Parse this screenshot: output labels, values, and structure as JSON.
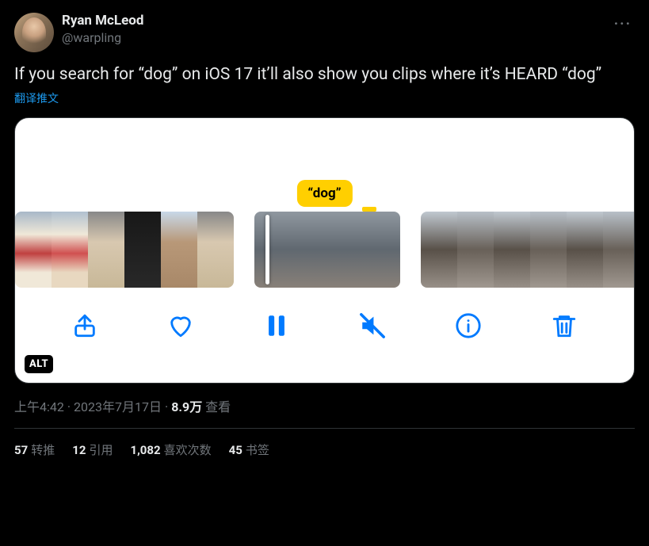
{
  "author": {
    "display_name": "Ryan McLeod",
    "handle": "@warpling"
  },
  "body": "If you search for “dog” on iOS 17 it’ll also show you clips where it’s HEARD “dog”",
  "translate_label": "翻译推文",
  "media": {
    "badge_text": "“dog”",
    "alt_label": "ALT",
    "toolbar_icons": {
      "share": "share-icon",
      "heart": "heart-icon",
      "pause": "pause-icon",
      "mute": "speaker-mute-icon",
      "info": "info-icon",
      "trash": "trash-icon"
    }
  },
  "meta": {
    "time": "上午4:42",
    "date": "2023年7月17日",
    "views_count": "8.9万",
    "views_label": "查看"
  },
  "stats": {
    "retweets": {
      "num": "57",
      "label": "转推"
    },
    "quotes": {
      "num": "12",
      "label": "引用"
    },
    "likes": {
      "num": "1,082",
      "label": "喜欢次数"
    },
    "bookmarks": {
      "num": "45",
      "label": "书签"
    }
  }
}
